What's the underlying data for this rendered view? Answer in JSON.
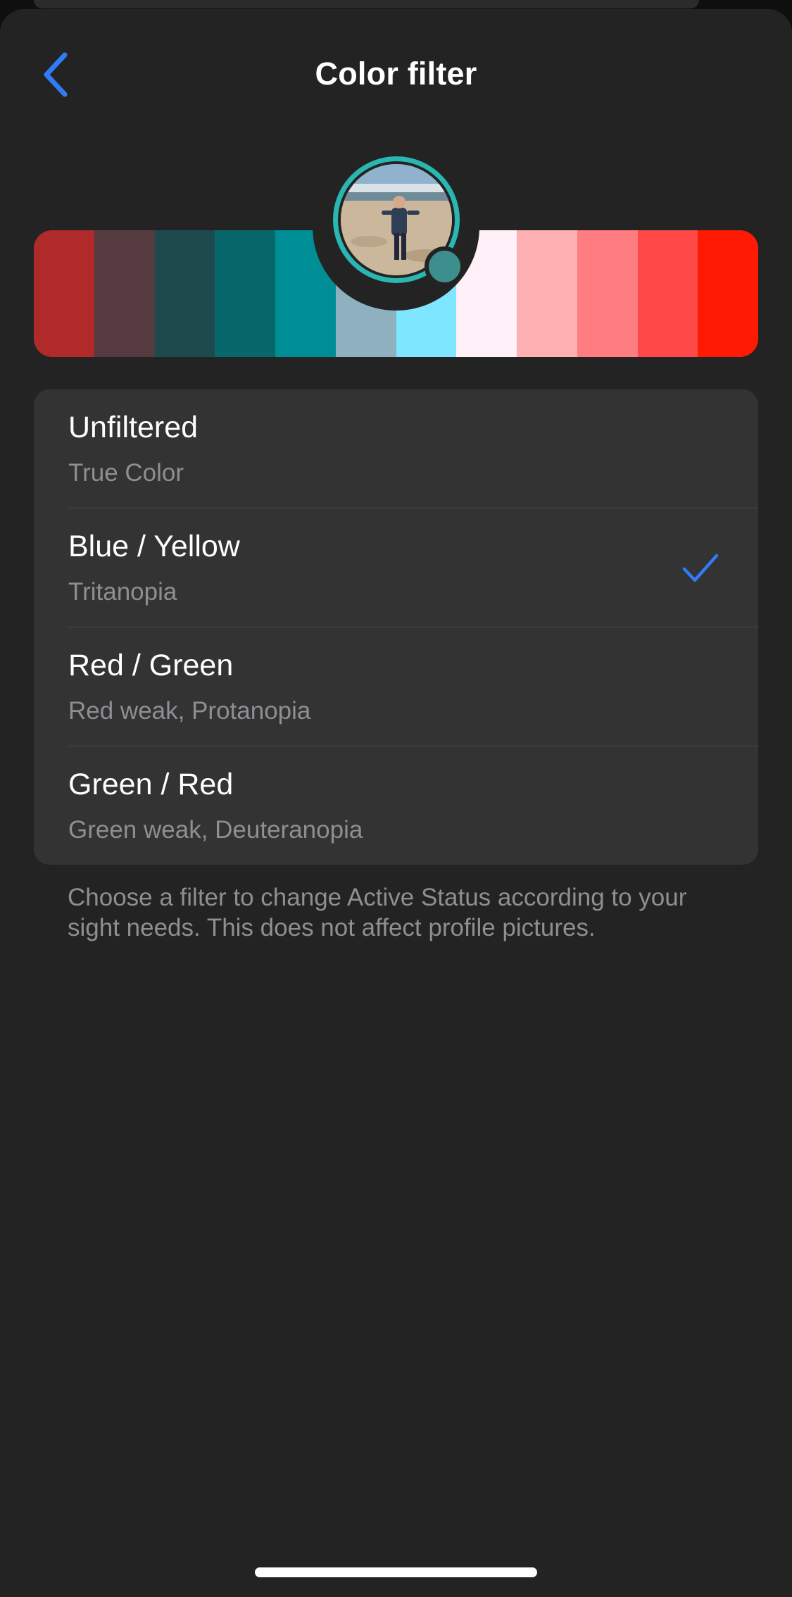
{
  "header": {
    "title": "Color filter"
  },
  "icons": {
    "back": "chevron-left-icon",
    "selected": "checkmark-icon"
  },
  "colors": {
    "accent": "#2f7cf6",
    "ring": "#2ab7b2",
    "status_dot": "#3c8f8d",
    "background": "#232323",
    "card": "#333333",
    "secondary_text": "#8e8e93"
  },
  "color_strip": [
    "#b02a2a",
    "#553a40",
    "#1c4a4d",
    "#08676a",
    "#008e96",
    "#8fb0bf",
    "#7fe6ff",
    "#fff1f7",
    "#ffb0b3",
    "#ff7c80",
    "#ff4848",
    "#ff1b03"
  ],
  "options": [
    {
      "title": "Unfiltered",
      "subtitle": "True Color",
      "selected": false
    },
    {
      "title": "Blue / Yellow",
      "subtitle": "Tritanopia",
      "selected": true
    },
    {
      "title": "Red / Green",
      "subtitle": "Red weak, Protanopia",
      "selected": false
    },
    {
      "title": "Green / Red",
      "subtitle": "Green weak, Deuteranopia",
      "selected": false
    }
  ],
  "footer": {
    "note": "Choose a filter to change Active Status according to your sight needs. This does not affect profile pictures."
  }
}
